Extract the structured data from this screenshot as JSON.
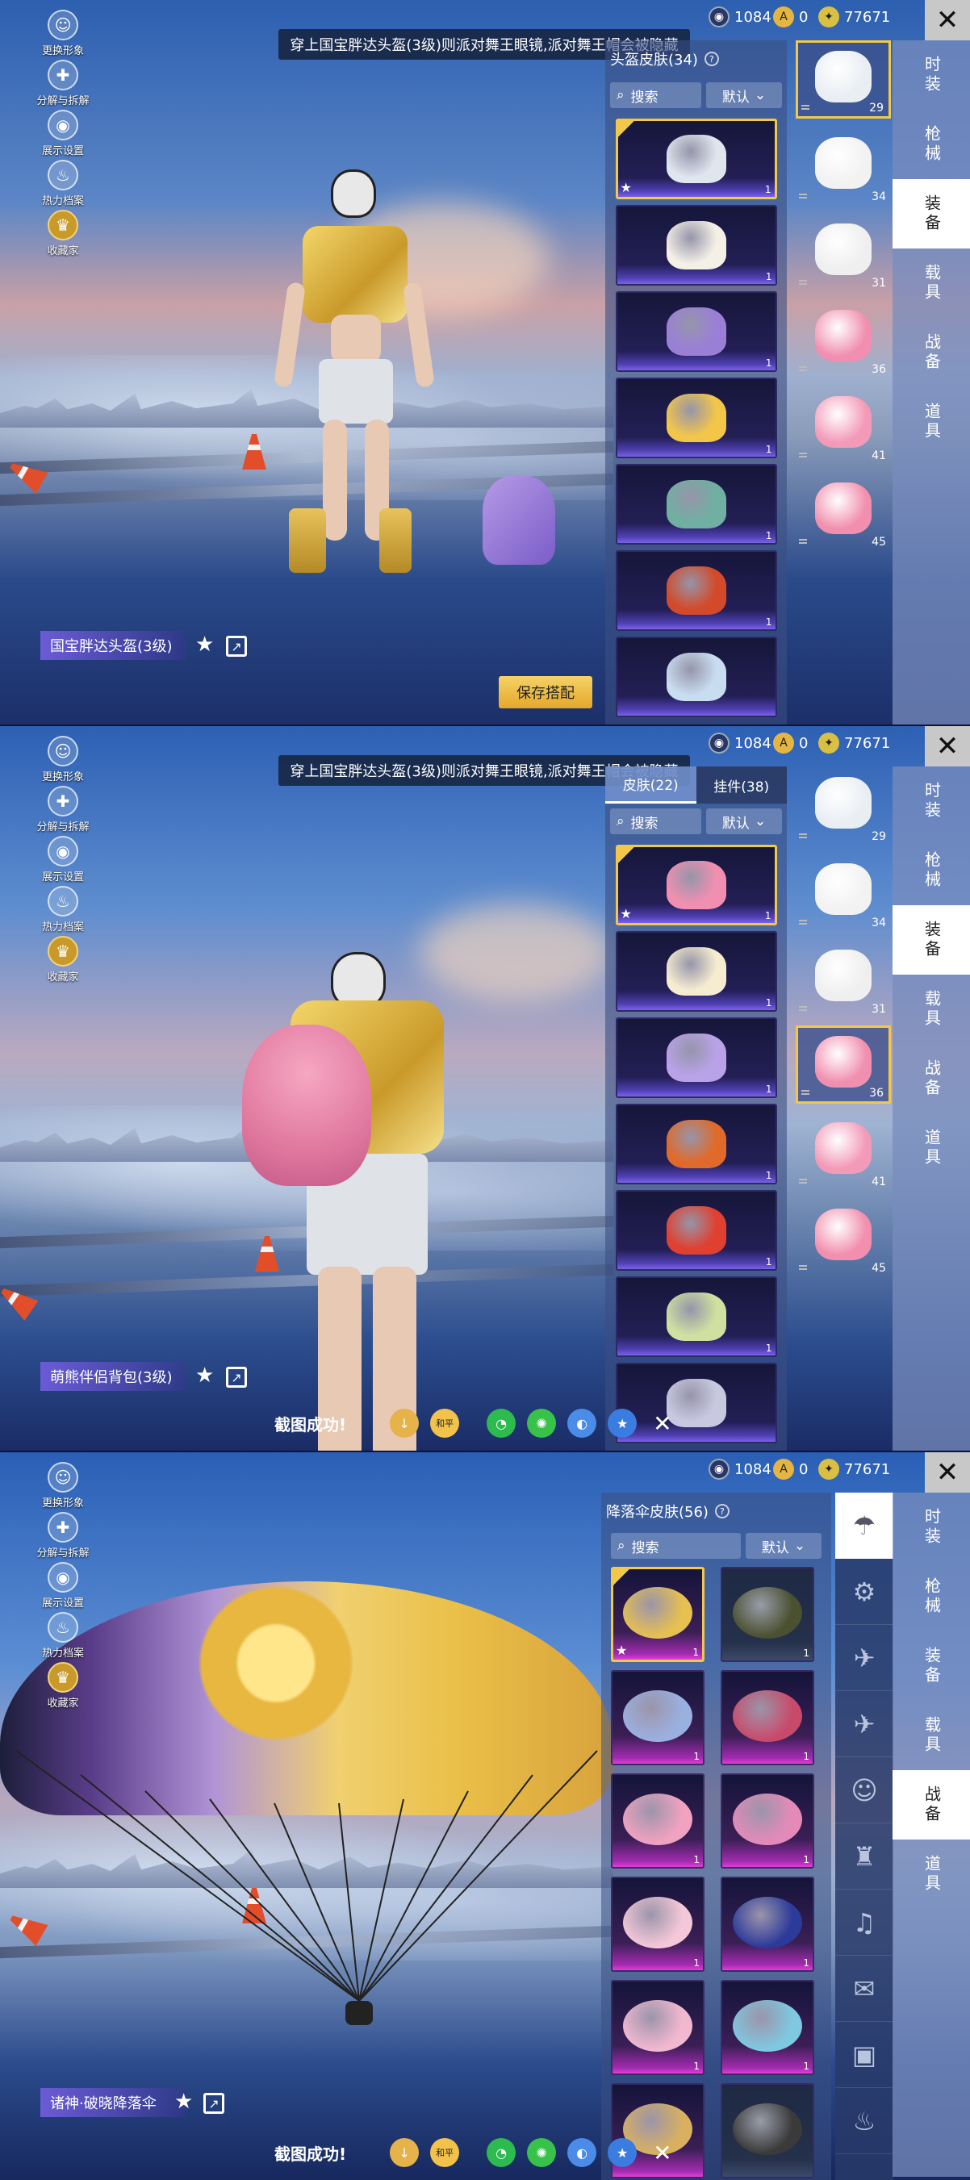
{
  "common": {
    "left_menu": [
      {
        "icon": "avatar-icon",
        "label": "更换形象"
      },
      {
        "icon": "puzzle-icon",
        "label": "分解与拆解"
      },
      {
        "icon": "eye-icon",
        "label": "展示设置"
      },
      {
        "icon": "flame-icon",
        "label": "热力档案"
      },
      {
        "icon": "collector-icon",
        "label": "收藏家"
      }
    ],
    "currency": {
      "silver": "1084",
      "gold": "0",
      "uc": "77671"
    },
    "close_glyph": "✕",
    "categories": [
      "时装",
      "枪械",
      "装备",
      "载具",
      "战备",
      "道具"
    ],
    "search_label": "搜索",
    "sort_label": "默认"
  },
  "panel1": {
    "notice": "穿上国宝胖达头盔(3级)则派对舞王眼镜,派对舞王帽会被隐藏",
    "inventory_title": "头盔皮肤(34)",
    "active_category": "装备",
    "item_name": "国宝胖达头盔(3级)",
    "save_button": "保存搭配",
    "cards": [
      {
        "num": "1",
        "color": "#dfe6ee"
      },
      {
        "num": "1",
        "color": "#f4f0e6"
      },
      {
        "num": "1",
        "color": "#9a7fd6"
      },
      {
        "num": "1",
        "color": "#f3c64a"
      },
      {
        "num": "1",
        "color": "#6fb0a2"
      },
      {
        "num": "1",
        "color": "#d24a2a"
      },
      {
        "num": "",
        "color": "#c9ddf0"
      }
    ],
    "equip": [
      {
        "lvl": "29",
        "color": "#e9eef3"
      },
      {
        "lvl": "34",
        "color": "#f2f2f2"
      },
      {
        "lvl": "31",
        "color": "#efefef"
      },
      {
        "lvl": "36",
        "color": "#f18fb0"
      },
      {
        "lvl": "41",
        "color": "#f39ab8"
      },
      {
        "lvl": "45",
        "color": "#f28fae"
      }
    ]
  },
  "panel2": {
    "notice": "穿上国宝胖达头盔(3级)则派对舞王眼镜,派对舞王帽会被隐藏",
    "tabs": [
      "皮肤(22)",
      "挂件(38)"
    ],
    "active_category": "装备",
    "item_name": "萌熊伴侣背包(3级)",
    "share_text": "截图成功!",
    "cards": [
      {
        "num": "1",
        "color": "#f18fb0"
      },
      {
        "num": "1",
        "color": "#f6ecd0"
      },
      {
        "num": "1",
        "color": "#b9a2e8"
      },
      {
        "num": "1",
        "color": "#e06a2a"
      },
      {
        "num": "1",
        "color": "#e04030"
      },
      {
        "num": "1",
        "color": "#cfe0a0"
      },
      {
        "num": "",
        "color": "#c8c8e0"
      }
    ],
    "equip": [
      {
        "lvl": "29",
        "color": "#e9eef3"
      },
      {
        "lvl": "34",
        "color": "#f2f2f2"
      },
      {
        "lvl": "31",
        "color": "#efefef"
      },
      {
        "lvl": "36",
        "color": "#f18fb0"
      },
      {
        "lvl": "41",
        "color": "#f39ab8"
      },
      {
        "lvl": "45",
        "color": "#f28fae"
      }
    ]
  },
  "panel3": {
    "inventory_title": "降落伞皮肤(56)",
    "active_category": "战备",
    "item_name": "诸神·破晓降落伞",
    "share_text": "截图成功!",
    "cards": [
      {
        "num": "1",
        "color": "#e6c050",
        "gray": false
      },
      {
        "num": "1",
        "color": "#4a5030",
        "gray": true
      },
      {
        "num": "1",
        "color": "#9ab0e0",
        "gray": false
      },
      {
        "num": "1",
        "color": "#c84a6a",
        "gray": false
      },
      {
        "num": "1",
        "color": "#f1a2c0",
        "gray": false
      },
      {
        "num": "1",
        "color": "#e58ab8",
        "gray": false
      },
      {
        "num": "1",
        "color": "#f4c8d8",
        "gray": false
      },
      {
        "num": "1",
        "color": "#2c3a9a",
        "gray": false
      },
      {
        "num": "1",
        "color": "#f2b8d0",
        "gray": false
      },
      {
        "num": "1",
        "color": "#7ec8e0",
        "gray": false
      },
      {
        "num": "",
        "color": "#d8b060",
        "gray": false
      },
      {
        "num": "",
        "color": "#3a3a3a",
        "gray": true
      }
    ],
    "side_icons": [
      "parachute-icon",
      "drone-icon",
      "plane-small-icon",
      "plane-icon",
      "emote-icon",
      "robot-icon",
      "speaker-icon",
      "chat-icon",
      "image-icon",
      "extinguisher-icon"
    ]
  }
}
